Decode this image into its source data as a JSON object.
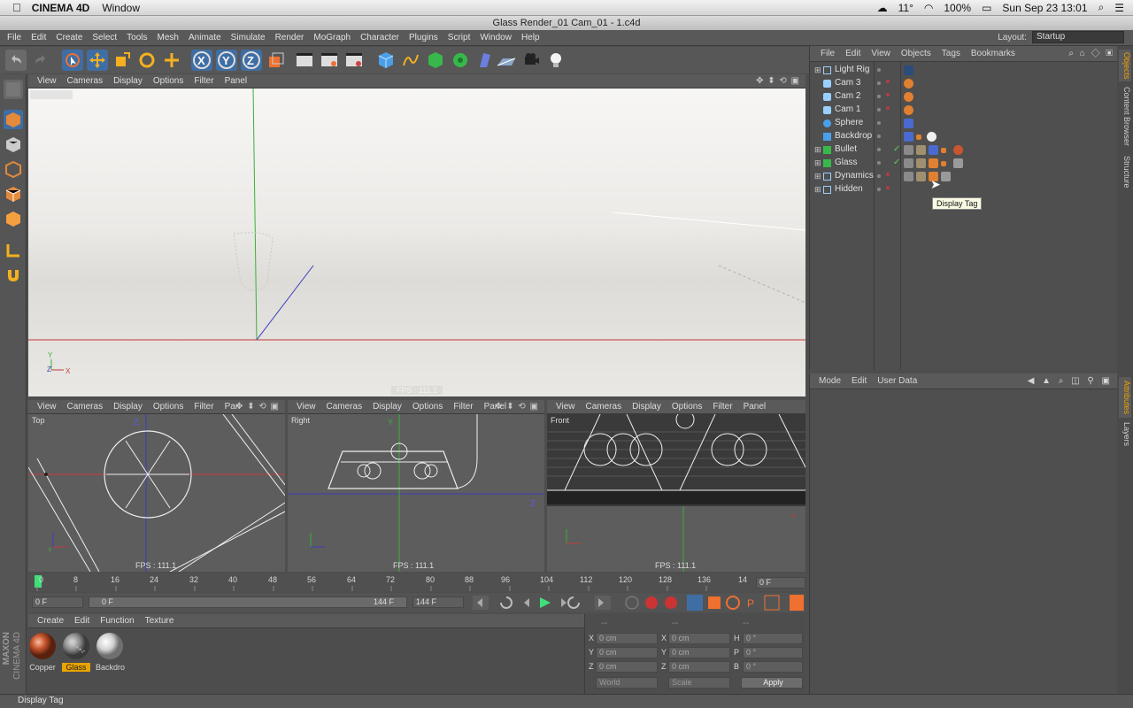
{
  "mac_menubar": {
    "app_name": "CINEMA 4D",
    "menus": [
      "Window"
    ],
    "status_items": [
      "11°",
      "100%",
      "Sun Sep 23  13:01"
    ]
  },
  "window_title": "Glass Render_01 Cam_01 - 1.c4d",
  "menubar": {
    "items": [
      "File",
      "Edit",
      "Create",
      "Select",
      "Tools",
      "Mesh",
      "Animate",
      "Simulate",
      "Render",
      "MoGraph",
      "Character",
      "Plugins",
      "Script",
      "Window",
      "Help"
    ],
    "layout_label": "Layout:",
    "layout_value": "Startup"
  },
  "main_viewport": {
    "menu": [
      "View",
      "Cameras",
      "Display",
      "Options",
      "Filter",
      "Panel"
    ],
    "fps": "FPS : 111.1"
  },
  "small_viewports": [
    {
      "label": "Top",
      "menu": [
        "View",
        "Cameras",
        "Display",
        "Options",
        "Filter",
        "Pan"
      ],
      "fps": "FPS : 111.1"
    },
    {
      "label": "Right",
      "menu": [
        "View",
        "Cameras",
        "Display",
        "Options",
        "Filter",
        "Panel"
      ],
      "fps": "FPS : 111.1"
    },
    {
      "label": "Front",
      "menu": [
        "View",
        "Cameras",
        "Display",
        "Options",
        "Filter",
        "Panel"
      ],
      "fps": "FPS : 111.1"
    }
  ],
  "timeline": {
    "ticks": [
      "0",
      "8",
      "16",
      "24",
      "32",
      "40",
      "48",
      "56",
      "64",
      "72",
      "80",
      "88",
      "96",
      "104",
      "112",
      "120",
      "128",
      "136",
      "14"
    ],
    "current_frame": "0 F",
    "start_frame": "0 F",
    "slider_start": "0 F",
    "slider_end": "144 F",
    "end_frame": "144 F"
  },
  "material_manager": {
    "menu": [
      "Create",
      "Edit",
      "Function",
      "Texture"
    ],
    "materials": [
      {
        "name": "Copper",
        "color": "#c8562e"
      },
      {
        "name": "Glass",
        "color": "#9a9a9a"
      },
      {
        "name": "Backdro",
        "color": "#f0f0f0"
      }
    ],
    "brand_top": "MAXON",
    "brand_bottom": "CINEMA 4D"
  },
  "coordinates": {
    "dashes": [
      "--",
      "--",
      "--"
    ],
    "rows": [
      {
        "a": "X",
        "av": "0 cm",
        "b": "X",
        "bv": "0 cm",
        "c": "H",
        "cv": "0 °"
      },
      {
        "a": "Y",
        "av": "0 cm",
        "b": "Y",
        "bv": "0 cm",
        "c": "P",
        "cv": "0 °"
      },
      {
        "a": "Z",
        "av": "0 cm",
        "b": "Z",
        "bv": "0 cm",
        "c": "B",
        "cv": "0 °"
      }
    ],
    "mode1": "World",
    "mode2": "Scale",
    "apply": "Apply"
  },
  "object_manager": {
    "menu": [
      "File",
      "Edit",
      "View",
      "Objects",
      "Tags",
      "Bookmarks"
    ],
    "objects": [
      {
        "name": "Light Rig",
        "expand": "⊞",
        "icon_color": "#9ad0ff"
      },
      {
        "name": "Cam 3",
        "expand": "",
        "icon_color": "#9ad0ff"
      },
      {
        "name": "Cam 2",
        "expand": "",
        "icon_color": "#9ad0ff"
      },
      {
        "name": "Cam 1",
        "expand": "",
        "icon_color": "#9ad0ff"
      },
      {
        "name": "Sphere",
        "expand": "",
        "icon_color": "#7ec7ff"
      },
      {
        "name": "Backdrop",
        "expand": "",
        "icon_color": "#7ec7ff"
      },
      {
        "name": "Bullet",
        "expand": "⊞",
        "icon_color": "#6ed46e"
      },
      {
        "name": "Glass",
        "expand": "⊞",
        "icon_color": "#6ed46e"
      },
      {
        "name": "Dynamics",
        "expand": "⊞",
        "icon_color": "#9ad0ff"
      },
      {
        "name": "Hidden",
        "expand": "⊞",
        "icon_color": "#9ad0ff"
      }
    ],
    "tooltip": "Display Tag"
  },
  "attributes": {
    "menu": [
      "Mode",
      "Edit",
      "User Data"
    ]
  },
  "right_tabs": [
    "Objects",
    "Content Browser",
    "Structure",
    "Attributes",
    "Layers"
  ],
  "statusbar": "Display Tag"
}
